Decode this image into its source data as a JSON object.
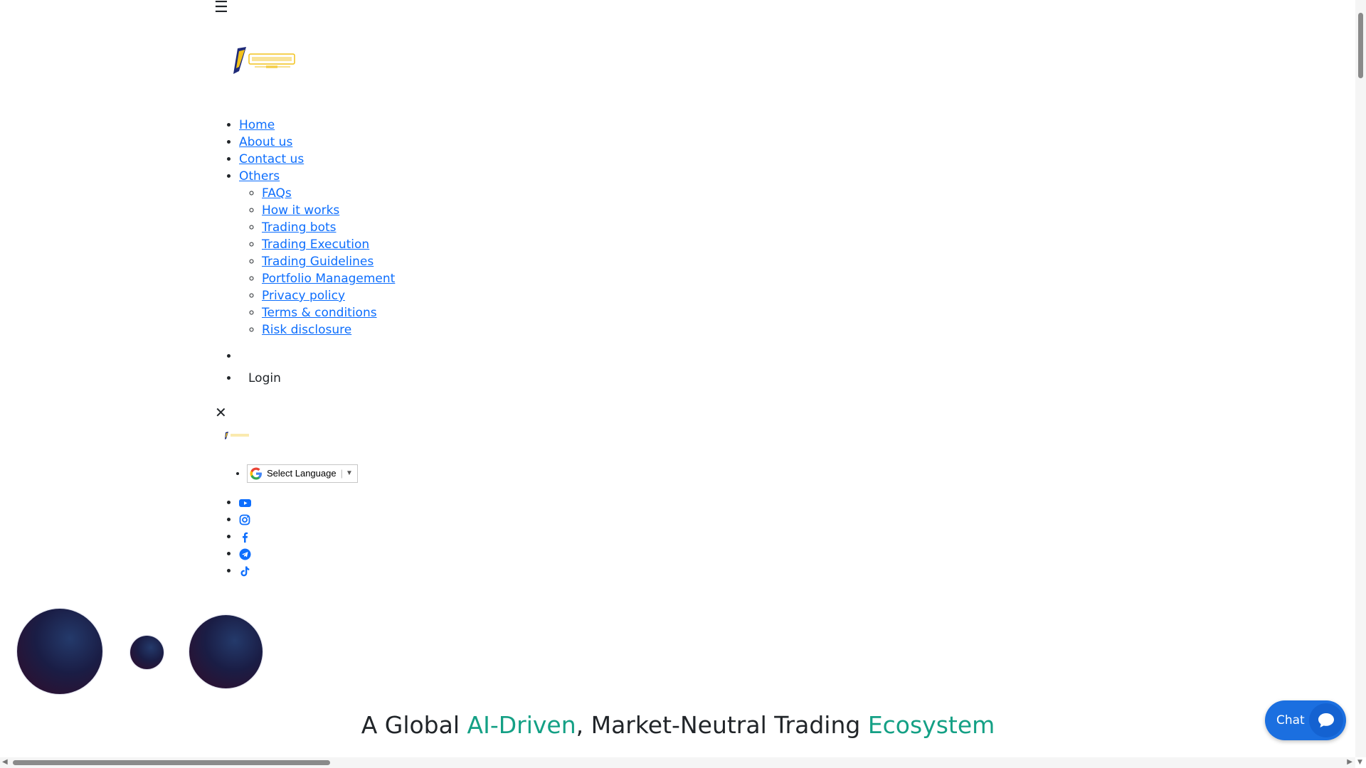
{
  "header": {
    "menu_icon": "hamburger-icon",
    "menu_glyph": "☰"
  },
  "logo": {
    "icon": "company-logo"
  },
  "nav": {
    "items": [
      {
        "label": "Home"
      },
      {
        "label": "About us"
      },
      {
        "label": "Contact us"
      },
      {
        "label": "Others"
      }
    ],
    "sub_items": [
      {
        "label": "FAQs"
      },
      {
        "label": "How it works"
      },
      {
        "label": "Trading bots"
      },
      {
        "label": "Trading Execution"
      },
      {
        "label": "Trading Guidelines"
      },
      {
        "label": "Portfolio Management"
      },
      {
        "label": "Privacy policy"
      },
      {
        "label": "Terms & conditions"
      },
      {
        "label": "Risk disclosure"
      }
    ]
  },
  "account": {
    "login_label": "Login"
  },
  "close": {
    "glyph": "✕",
    "icon": "close-icon"
  },
  "language": {
    "label": "Select Language",
    "arrow": "▼",
    "icon": "google-icon"
  },
  "social": {
    "icons": [
      "youtube-icon",
      "instagram-icon",
      "facebook-icon",
      "telegram-icon",
      "tiktok-icon"
    ]
  },
  "hero": {
    "part1": "A Global ",
    "accent1": "AI-Driven",
    "part2": ", Market-Neutral Trading ",
    "accent2": "Ecosystem"
  },
  "chat": {
    "label": "Chat",
    "icon": "chat-bubble-icon"
  },
  "colors": {
    "link": "#0d6efd",
    "accent": "#14a085",
    "chat": "#1b6fe0",
    "text": "#212529"
  }
}
